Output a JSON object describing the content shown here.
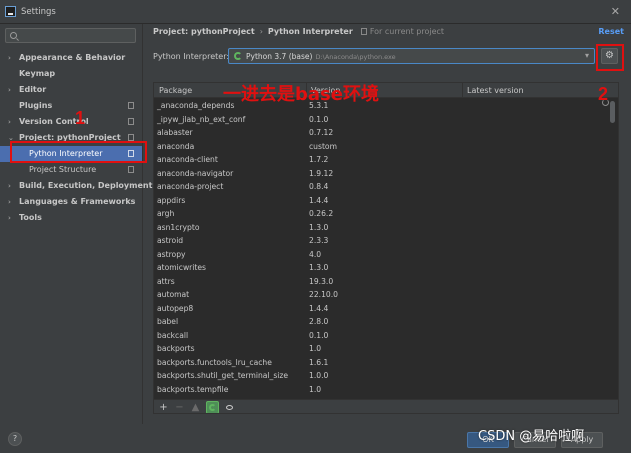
{
  "window": {
    "title": "Settings"
  },
  "sidebar": {
    "search_placeholder": "",
    "items": [
      {
        "label": "Appearance & Behavior",
        "arrow": "›"
      },
      {
        "label": "Keymap",
        "arrow": ""
      },
      {
        "label": "Editor",
        "arrow": "›"
      },
      {
        "label": "Plugins",
        "arrow": ""
      },
      {
        "label": "Version Control",
        "arrow": "›"
      },
      {
        "label": "Project: pythonProject",
        "arrow": "⌄"
      },
      {
        "label": "Python Interpreter",
        "arrow": ""
      },
      {
        "label": "Project Structure",
        "arrow": ""
      },
      {
        "label": "Build, Execution, Deployment",
        "arrow": "›"
      },
      {
        "label": "Languages & Frameworks",
        "arrow": "›"
      },
      {
        "label": "Tools",
        "arrow": "›"
      }
    ]
  },
  "breadcrumb": {
    "project": "Project: pythonProject",
    "separator": "›",
    "page": "Python Interpreter",
    "hint": "For current project"
  },
  "reset_label": "Reset",
  "interpreter": {
    "label": "Python Interpreter:",
    "value": "Python 3.7 (base)",
    "path": "D:\\Anaconda\\python.exe",
    "gear_icon": "gear-icon"
  },
  "table": {
    "columns": [
      "Package",
      "Version",
      "Latest version"
    ],
    "rows": [
      {
        "name": "_anaconda_depends",
        "version": "5.3.1",
        "latest": ""
      },
      {
        "name": "_ipyw_jlab_nb_ext_conf",
        "version": "0.1.0",
        "latest": ""
      },
      {
        "name": "alabaster",
        "version": "0.7.12",
        "latest": ""
      },
      {
        "name": "anaconda",
        "version": "custom",
        "latest": ""
      },
      {
        "name": "anaconda-client",
        "version": "1.7.2",
        "latest": ""
      },
      {
        "name": "anaconda-navigator",
        "version": "1.9.12",
        "latest": ""
      },
      {
        "name": "anaconda-project",
        "version": "0.8.4",
        "latest": ""
      },
      {
        "name": "appdirs",
        "version": "1.4.4",
        "latest": ""
      },
      {
        "name": "argh",
        "version": "0.26.2",
        "latest": ""
      },
      {
        "name": "asn1crypto",
        "version": "1.3.0",
        "latest": ""
      },
      {
        "name": "astroid",
        "version": "2.3.3",
        "latest": ""
      },
      {
        "name": "astropy",
        "version": "4.0",
        "latest": ""
      },
      {
        "name": "atomicwrites",
        "version": "1.3.0",
        "latest": ""
      },
      {
        "name": "attrs",
        "version": "19.3.0",
        "latest": ""
      },
      {
        "name": "automat",
        "version": "22.10.0",
        "latest": ""
      },
      {
        "name": "autopep8",
        "version": "1.4.4",
        "latest": ""
      },
      {
        "name": "babel",
        "version": "2.8.0",
        "latest": ""
      },
      {
        "name": "backcall",
        "version": "0.1.0",
        "latest": ""
      },
      {
        "name": "backports",
        "version": "1.0",
        "latest": ""
      },
      {
        "name": "backports.functools_lru_cache",
        "version": "1.6.1",
        "latest": ""
      },
      {
        "name": "backports.shutil_get_terminal_size",
        "version": "1.0.0",
        "latest": ""
      },
      {
        "name": "backports.tempfile",
        "version": "1.0",
        "latest": ""
      }
    ],
    "tools": {
      "add": "+",
      "remove": "−",
      "upgrade": "▲"
    }
  },
  "footer": {
    "help": "?",
    "ok": "OK",
    "cancel": "Cancel",
    "apply": "Apply"
  },
  "watermark": "CSDN @易哈啦啊",
  "annotations": {
    "num1": "1",
    "num2": "2",
    "note": "一进去是base环境",
    "color": "#e01010"
  }
}
